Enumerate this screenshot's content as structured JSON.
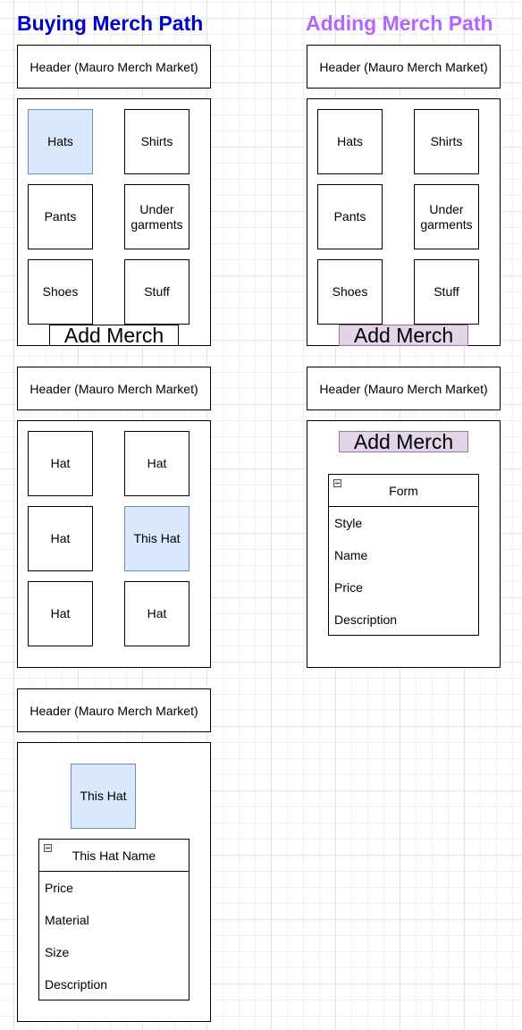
{
  "titles": {
    "buying": "Buying Merch Path",
    "adding": "Adding Merch Path"
  },
  "colors": {
    "buying_title": "#0000cc",
    "adding_title": "#b266ff",
    "selected_fill": "#dae8fc",
    "selected_border": "#6c8ebf",
    "purple_fill": "#e1d5e7",
    "purple_border": "#9673a6",
    "grid": "#e1e1e1"
  },
  "header_text": "Header (Mauro Merch Market)",
  "categories": [
    "Hats",
    "Shirts",
    "Pants",
    "Under garments",
    "Shoes",
    "Stuff"
  ],
  "add_merch": "Add Merch",
  "hat_list": [
    "Hat",
    "Hat",
    "Hat",
    "This Hat",
    "Hat",
    "Hat"
  ],
  "product_detail": {
    "image_label": "This Hat",
    "form_title": "This Hat Name",
    "fields": [
      "Price",
      "Material",
      "Size",
      "Description"
    ]
  },
  "add_form": {
    "title": "Form",
    "fields": [
      "Style",
      "Name",
      "Price",
      "Description"
    ]
  }
}
